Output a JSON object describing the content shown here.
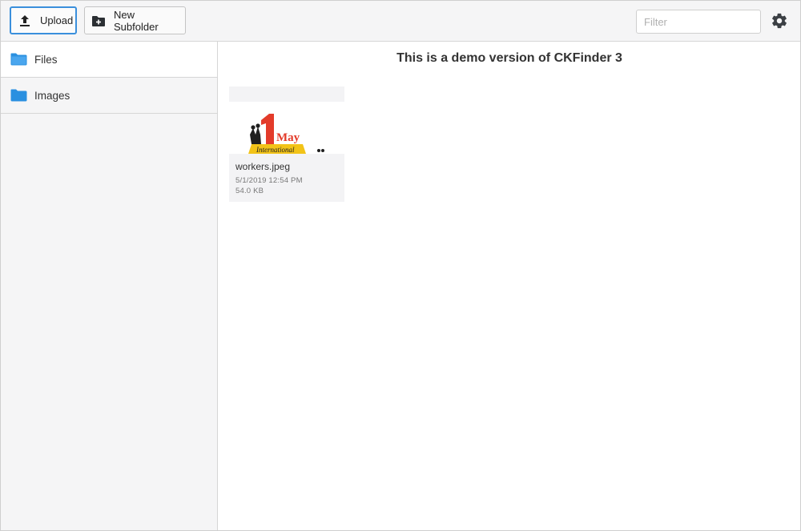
{
  "toolbar": {
    "upload_label": "Upload",
    "upload_icon": "upload-icon",
    "new_subfolder_label": "New Subfolder",
    "new_subfolder_icon": "folder-plus-icon",
    "filter_placeholder": "Filter",
    "filter_value": "",
    "settings_icon": "gear-icon"
  },
  "sidebar": {
    "items": [
      {
        "label": "Files",
        "icon": "folder-icon",
        "active": true
      },
      {
        "label": "Images",
        "icon": "folder-icon",
        "active": false
      }
    ]
  },
  "main": {
    "banner": "This is a demo version of CKFinder 3",
    "files": [
      {
        "name": "workers.jpeg",
        "date": "5/1/2019 12:54 PM",
        "size": "54.0 KB"
      }
    ]
  },
  "colors": {
    "accent": "#3a8fdc",
    "folder": "#2a90e0",
    "toolbar_bg": "#f5f5f6"
  }
}
